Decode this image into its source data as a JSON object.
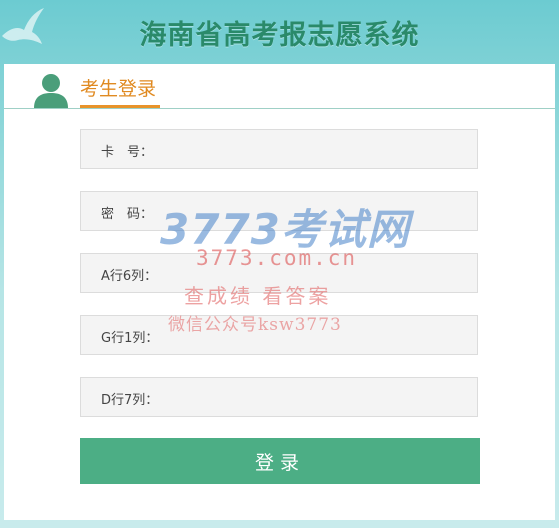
{
  "header": {
    "title": "海南省高考报志愿系统"
  },
  "login": {
    "tab_label": "考生登录",
    "fields": [
      {
        "label": "卡　号：",
        "value": ""
      },
      {
        "label": "密　码：",
        "value": ""
      },
      {
        "label": "A行6列：",
        "value": ""
      },
      {
        "label": "G行1列：",
        "value": ""
      },
      {
        "label": "D行7列：",
        "value": ""
      }
    ],
    "submit_label": "登录"
  },
  "watermark": {
    "logo_text": "3773考试网",
    "domain": "3773.com.cn",
    "slogan": "查成绩 看答案",
    "wechat": "微信公众号ksw3773"
  },
  "icons": {
    "bird": "bird-icon",
    "avatar": "user-avatar-icon"
  },
  "colors": {
    "title": "#2a8a6a",
    "tab_accent": "#e08a21",
    "button": "#4cae85",
    "background": "#86d4d7"
  }
}
